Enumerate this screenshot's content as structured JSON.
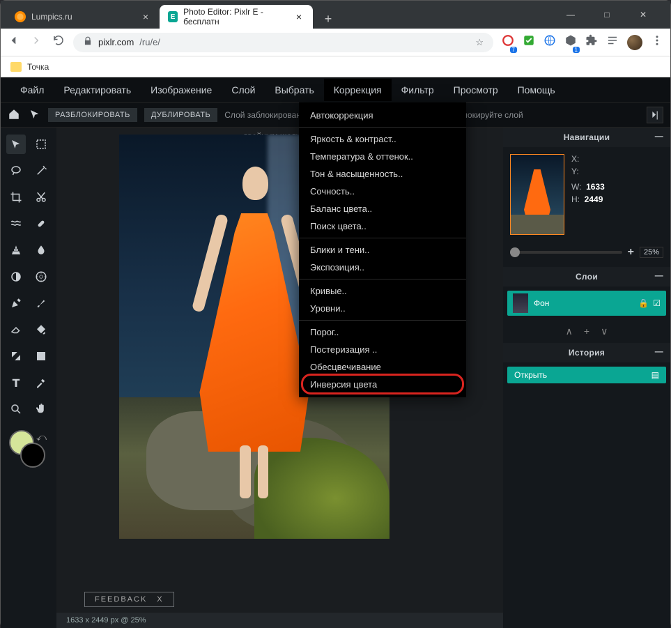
{
  "browser": {
    "tabs": [
      {
        "title": "Lumpics.ru",
        "active": false,
        "favicon": "orange"
      },
      {
        "title": "Photo Editor: Pixlr E - бесплатн",
        "active": true,
        "favicon": "teal"
      }
    ],
    "url_host": "pixlr.com",
    "url_path": "/ru/e/",
    "bookmark": "Точка",
    "win": {
      "min": "—",
      "max": "□",
      "close": "✕"
    }
  },
  "app": {
    "menubar": [
      "Файл",
      "Редактировать",
      "Изображение",
      "Слой",
      "Выбрать",
      "Коррекция",
      "Фильтр",
      "Просмотр",
      "Помощь"
    ],
    "menubar_open_index": 5,
    "toolbar": {
      "unlock": "РАЗБЛОКИРОВАТЬ",
      "duplicate": "ДУБЛИРОВАТЬ",
      "lock_msg": "Слой заблокирован. Чтобы выполнить преобразования, разблокируйте слой"
    },
    "canvas_hint": "двойным щелчком.",
    "dropdown": {
      "groups": [
        [
          "Автокоррекция"
        ],
        [
          "Яркость & контраст..",
          "Температура & оттенок..",
          "Тон & насыщенность..",
          "Сочность..",
          "Баланс цвета..",
          "Поиск цвета.."
        ],
        [
          "Блики и тени..",
          "Экспозиция.."
        ],
        [
          "Кривые..",
          "Уровни.."
        ],
        [
          "Порог..",
          "Постеризация ..",
          "Обесцвечивание",
          "Инверсия цвета"
        ]
      ],
      "highlight": "Инверсия цвета"
    },
    "feedback": {
      "label": "FEEDBACK",
      "close": "X"
    },
    "status": "1633 x 2449 px @ 25%",
    "panels": {
      "nav": {
        "title": "Навигации",
        "x_label": "X:",
        "y_label": "Y:",
        "w_label": "W:",
        "w_val": "1633",
        "h_label": "H:",
        "h_val": "2449",
        "zoom": "25%"
      },
      "layers": {
        "title": "Слои",
        "bg": "Фон"
      },
      "history": {
        "title": "История",
        "open": "Открыть"
      }
    },
    "colors": {
      "accent": "#0aa693",
      "highlight_ring": "#d9241f",
      "swatch1": "#d5e59a",
      "swatch2": "#000000"
    }
  }
}
